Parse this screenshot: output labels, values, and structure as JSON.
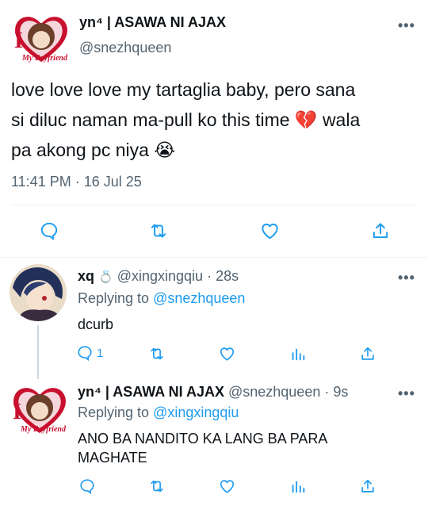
{
  "main_tweet": {
    "display_name": "yn⁴ | ASAWA NI AJAX",
    "handle": "@snezhqueen",
    "text_line1": "love love love my tartaglia baby, pero sana",
    "text_line2": "si diluc naman ma-pull ko this time 💔  wala",
    "text_line3": "pa akong pc niya 😭",
    "time": "11:41 PM · 16 Jul 25",
    "avatar_badge": "My Boyfriend"
  },
  "reply1": {
    "display_name": "xq",
    "name_emoji": "💍",
    "handle": "@xingxingqiu",
    "time": "· 28s",
    "replying_prefix": "Replying to",
    "replying_to": "@snezhqueen",
    "text": "dcurb",
    "reply_count": "1"
  },
  "reply2": {
    "display_name": "yn⁴ | ASAWA NI AJAX",
    "handle": "@snezhqueen",
    "time": "· 9s",
    "replying_prefix": "Replying to",
    "replying_to": "@xingxingqiu",
    "text_line1": "ANO BA NANDITO KA LANG BA PARA",
    "text_line2": "MAGHATE",
    "avatar_badge": "My Boyfriend"
  },
  "more_label": "•••",
  "colors": {
    "accent": "#1d9bf0",
    "muted": "#536471",
    "heart": "#c8102e"
  }
}
